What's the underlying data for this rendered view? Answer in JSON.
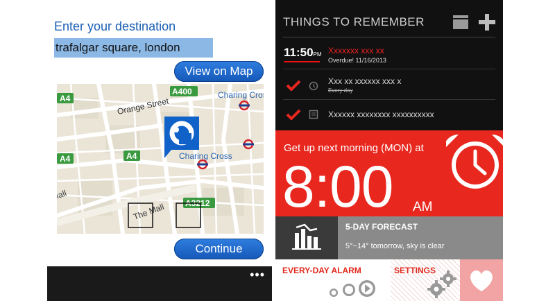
{
  "navigator": {
    "destination_label": "Enter your destination",
    "destination_value": "trafalgar square, london",
    "view_on_map": "View on Map",
    "continue": "Continue",
    "app_bar_more": "•••",
    "map": {
      "road_labels": [
        "A4",
        "A400",
        "A4",
        "A4",
        "A3212"
      ],
      "place_labels": [
        "Orange Street",
        "Charing Cross",
        "Charing Cross",
        "The Mall",
        "Mall"
      ],
      "marker_icon": "location-pin-icon",
      "station_icon": "underground-roundel-icon"
    }
  },
  "alarm_app": {
    "things_title": "THINGS TO REMEMBER",
    "tasks": [
      {
        "time": "11:50",
        "ampm": "PM",
        "title": "Xxxxxxx xxx xx",
        "subtitle": "Overdue! 11/16/2013"
      },
      {
        "title": "Xxx xx xxxxxx xxx x",
        "subtitle": "Every day"
      },
      {
        "title": "Xxxxxx xxxxxxxx xxxxxxxxxx"
      }
    ],
    "alarm_label": "Get up next morning (MON) at",
    "alarm_time": "8:00",
    "alarm_ampm": "AM",
    "forecast_title": "5-DAY FORECAST",
    "forecast_text": "5°~14° tomorrow, sky is clear",
    "every_day_alarm": "EVERY-DAY ALARM",
    "settings": "SETTINGS",
    "colors": {
      "accent_red": "#e8271f",
      "tile_gray": "#8a8a8a",
      "heart_pink": "#f2a3a3",
      "map_blue": "#1b5fb4"
    }
  }
}
